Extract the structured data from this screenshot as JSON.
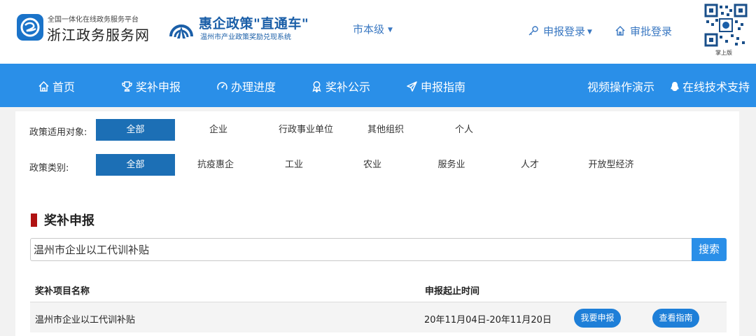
{
  "header": {
    "platform_small": "全国一体化在线政务服务平台",
    "platform_name": "浙江政务服务网",
    "brand_title": "惠企政策\"直通车\"",
    "brand_subtitle": "温州市产业政策奖励兑现系统",
    "level_select": "市本级",
    "apply_login": "申报登录",
    "approve_login": "审批登录",
    "qr_label": "掌上版"
  },
  "nav": {
    "items": [
      {
        "label": "首页",
        "icon": "home-icon"
      },
      {
        "label": "奖补申报",
        "icon": "trophy-icon"
      },
      {
        "label": "办理进度",
        "icon": "gauge-icon"
      },
      {
        "label": "奖补公示",
        "icon": "award-icon"
      },
      {
        "label": "申报指南",
        "icon": "paper-plane-icon"
      }
    ],
    "video_demo": "视频操作演示",
    "online_support": "在线技术支持"
  },
  "filters": {
    "target": {
      "label": "政策适用对象:",
      "options": [
        "全部",
        "企业",
        "行政事业单位",
        "其他组织",
        "个人"
      ],
      "selected": "全部"
    },
    "category": {
      "label": "政策类别:",
      "options": [
        "全部",
        "抗疫惠企",
        "工业",
        "农业",
        "服务业",
        "人才",
        "开放型经济"
      ],
      "selected": "全部"
    }
  },
  "section": {
    "title": "奖补申报"
  },
  "search": {
    "value": "温州市企业以工代训补贴",
    "button": "搜索"
  },
  "table": {
    "headers": [
      "奖补项目名称",
      "申报起止时间"
    ],
    "rows": [
      {
        "name": "温州市企业以工代训补贴",
        "period": "20年11月04日-20年11月20日",
        "apply_button": "我要申报",
        "guide_button": "查看指南"
      }
    ]
  },
  "colors": {
    "nav_bg": "#2a8fe8",
    "active_filter": "#1c6fb5",
    "accent_text": "#3a78c2",
    "section_bar": "#b01212",
    "pill_button": "#1e7fd8"
  }
}
